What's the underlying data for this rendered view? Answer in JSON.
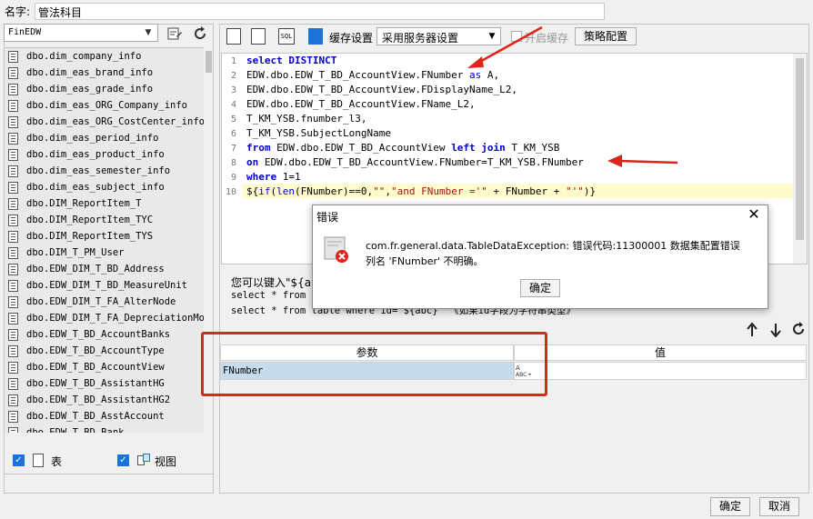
{
  "name_row": {
    "label": "名字:",
    "value": "管法科目"
  },
  "datasource": {
    "selected": "FinEDW"
  },
  "tables": [
    "dbo.dim_company_info",
    "dbo.dim_eas_brand_info",
    "dbo.dim_eas_grade_info",
    "dbo.dim_eas_ORG_Company_info",
    "dbo.dim_eas_ORG_CostCenter_info",
    "dbo.dim_eas_period_info",
    "dbo.dim_eas_product_info",
    "dbo.dim_eas_semester_info",
    "dbo.dim_eas_subject_info",
    "dbo.DIM_ReportItem_T",
    "dbo.DIM_ReportItem_TYC",
    "dbo.DIM_ReportItem_TYS",
    "dbo.DIM_T_PM_User",
    "dbo.EDW_DIM_T_BD_Address",
    "dbo.EDW_DIM_T_BD_MeasureUnit",
    "dbo.EDW_DIM_T_FA_AlterNode",
    "dbo.EDW_DIM_T_FA_DepreciationMode",
    "dbo.EDW_T_BD_AccountBanks",
    "dbo.EDW_T_BD_AccountType",
    "dbo.EDW_T_BD_AccountView",
    "dbo.EDW_T_BD_AssistantHG",
    "dbo.EDW_T_BD_AssistantHG2",
    "dbo.EDW_T_BD_AsstAccount",
    "dbo.EDW_T_BD_Bank"
  ],
  "filters": {
    "table_label": "表",
    "view_label": "视图"
  },
  "toolbar": {
    "icons": [
      "preview-icon",
      "save-icon",
      "sql-icon",
      "cache-icon"
    ],
    "sql_icon_text": "SQL",
    "cache_label": "缓存设置",
    "cache_select": "采用服务器设置",
    "enable_cache_label": "开启缓存",
    "policy_button": "策略配置"
  },
  "editor": {
    "line_numbers": [
      "1",
      "2",
      "3",
      "4",
      "5",
      "6",
      "7",
      "8",
      "9",
      "10"
    ]
  },
  "hint": {
    "line1": "您可以键入\"${abc}\"",
    "line2": "select * from t",
    "line3": "select * from table where id='${abc}' 《如果id字段为字符串类型》"
  },
  "param_table": {
    "headers": [
      "参数",
      "值"
    ],
    "rows": [
      {
        "name": "FNumber",
        "value": ""
      }
    ],
    "type_icon_text": "ABC"
  },
  "dialog": {
    "title": "错误",
    "message_line1": "com.fr.general.data.TableDataException: 错误代码:11300001 数据集配置错误",
    "message_line2": "列名 'FNumber' 不明确。",
    "ok": "确定"
  },
  "footer": {
    "ok": "确定",
    "cancel": "取消"
  },
  "colors": {
    "accent": "#1a73d9",
    "keyword": "#0000c8",
    "annotation_red": "#e0231c",
    "line_highlight": "#fffbcc"
  }
}
